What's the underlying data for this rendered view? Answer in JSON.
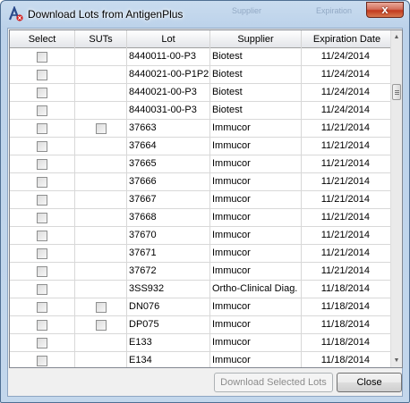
{
  "window": {
    "title": "Download Lots from AntigenPlus",
    "close_glyph": "x",
    "background_ghost": [
      "Supplier",
      "Expiration"
    ]
  },
  "grid": {
    "columns": [
      "Select",
      "SUTs",
      "Lot",
      "Supplier",
      "Expiration Date"
    ],
    "rows": [
      {
        "select": false,
        "has_suts": false,
        "lot": "8440011-00-P3",
        "supplier": "Biotest",
        "expiration": "11/24/2014"
      },
      {
        "select": false,
        "has_suts": false,
        "lot": "8440021-00-P1P2",
        "supplier": "Biotest",
        "expiration": "11/24/2014"
      },
      {
        "select": false,
        "has_suts": false,
        "lot": "8440021-00-P3",
        "supplier": "Biotest",
        "expiration": "11/24/2014"
      },
      {
        "select": false,
        "has_suts": false,
        "lot": "8440031-00-P3",
        "supplier": "Biotest",
        "expiration": "11/24/2014"
      },
      {
        "select": false,
        "has_suts": true,
        "lot": "37663",
        "supplier": "Immucor",
        "expiration": "11/21/2014"
      },
      {
        "select": false,
        "has_suts": false,
        "lot": "37664",
        "supplier": "Immucor",
        "expiration": "11/21/2014"
      },
      {
        "select": false,
        "has_suts": false,
        "lot": "37665",
        "supplier": "Immucor",
        "expiration": "11/21/2014"
      },
      {
        "select": false,
        "has_suts": false,
        "lot": "37666",
        "supplier": "Immucor",
        "expiration": "11/21/2014"
      },
      {
        "select": false,
        "has_suts": false,
        "lot": "37667",
        "supplier": "Immucor",
        "expiration": "11/21/2014"
      },
      {
        "select": false,
        "has_suts": false,
        "lot": "37668",
        "supplier": "Immucor",
        "expiration": "11/21/2014"
      },
      {
        "select": false,
        "has_suts": false,
        "lot": "37670",
        "supplier": "Immucor",
        "expiration": "11/21/2014"
      },
      {
        "select": false,
        "has_suts": false,
        "lot": "37671",
        "supplier": "Immucor",
        "expiration": "11/21/2014"
      },
      {
        "select": false,
        "has_suts": false,
        "lot": "37672",
        "supplier": "Immucor",
        "expiration": "11/21/2014"
      },
      {
        "select": false,
        "has_suts": false,
        "lot": "3SS932",
        "supplier": "Ortho-Clinical Diag.",
        "expiration": "11/18/2014"
      },
      {
        "select": false,
        "has_suts": true,
        "lot": "DN076",
        "supplier": "Immucor",
        "expiration": "11/18/2014"
      },
      {
        "select": false,
        "has_suts": true,
        "lot": "DP075",
        "supplier": "Immucor",
        "expiration": "11/18/2014"
      },
      {
        "select": false,
        "has_suts": false,
        "lot": "E133",
        "supplier": "Immucor",
        "expiration": "11/18/2014"
      },
      {
        "select": false,
        "has_suts": false,
        "lot": "E134",
        "supplier": "Immucor",
        "expiration": "11/18/2014"
      }
    ]
  },
  "buttons": {
    "download": "Download Selected Lots",
    "close": "Close"
  },
  "icons": {
    "app": "antigenplus-icon",
    "scroll_up": "scroll-up-icon",
    "scroll_down": "scroll-down-icon"
  },
  "colors": {
    "window_frame": "#bcd2ea",
    "close_button": "#c23a1f",
    "grid_lines": "#d8d8d8"
  }
}
